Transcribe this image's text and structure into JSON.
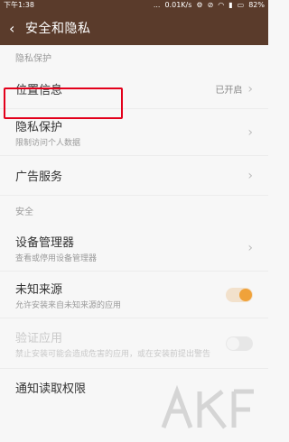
{
  "status_bar": {
    "time": "下午1:38",
    "center": "...",
    "speed": "0.01K/s",
    "battery": "82%"
  },
  "header": {
    "back_glyph": "‹",
    "title": "安全和隐私"
  },
  "section_privacy": "隐私保护",
  "location": {
    "label": "位置信息",
    "value": "已开启"
  },
  "privacy": {
    "label": "隐私保护",
    "sub": "限制访问个人数据"
  },
  "ads": {
    "label": "广告服务"
  },
  "section_security": "安全",
  "device_manager": {
    "label": "设备管理器",
    "sub": "查看或停用设备管理器"
  },
  "unknown_sources": {
    "label": "未知来源",
    "sub": "允许安装来自未知来源的应用",
    "enabled": true
  },
  "verify_apps": {
    "label": "验证应用",
    "sub": "禁止安装可能会造成危害的应用，或在安装前提出警告",
    "enabled": false
  },
  "notification_access": {
    "label": "通知读取权限"
  },
  "colors": {
    "header": "#5a3b2b",
    "accent": "#f0a23a",
    "highlight": "#e3001b"
  }
}
